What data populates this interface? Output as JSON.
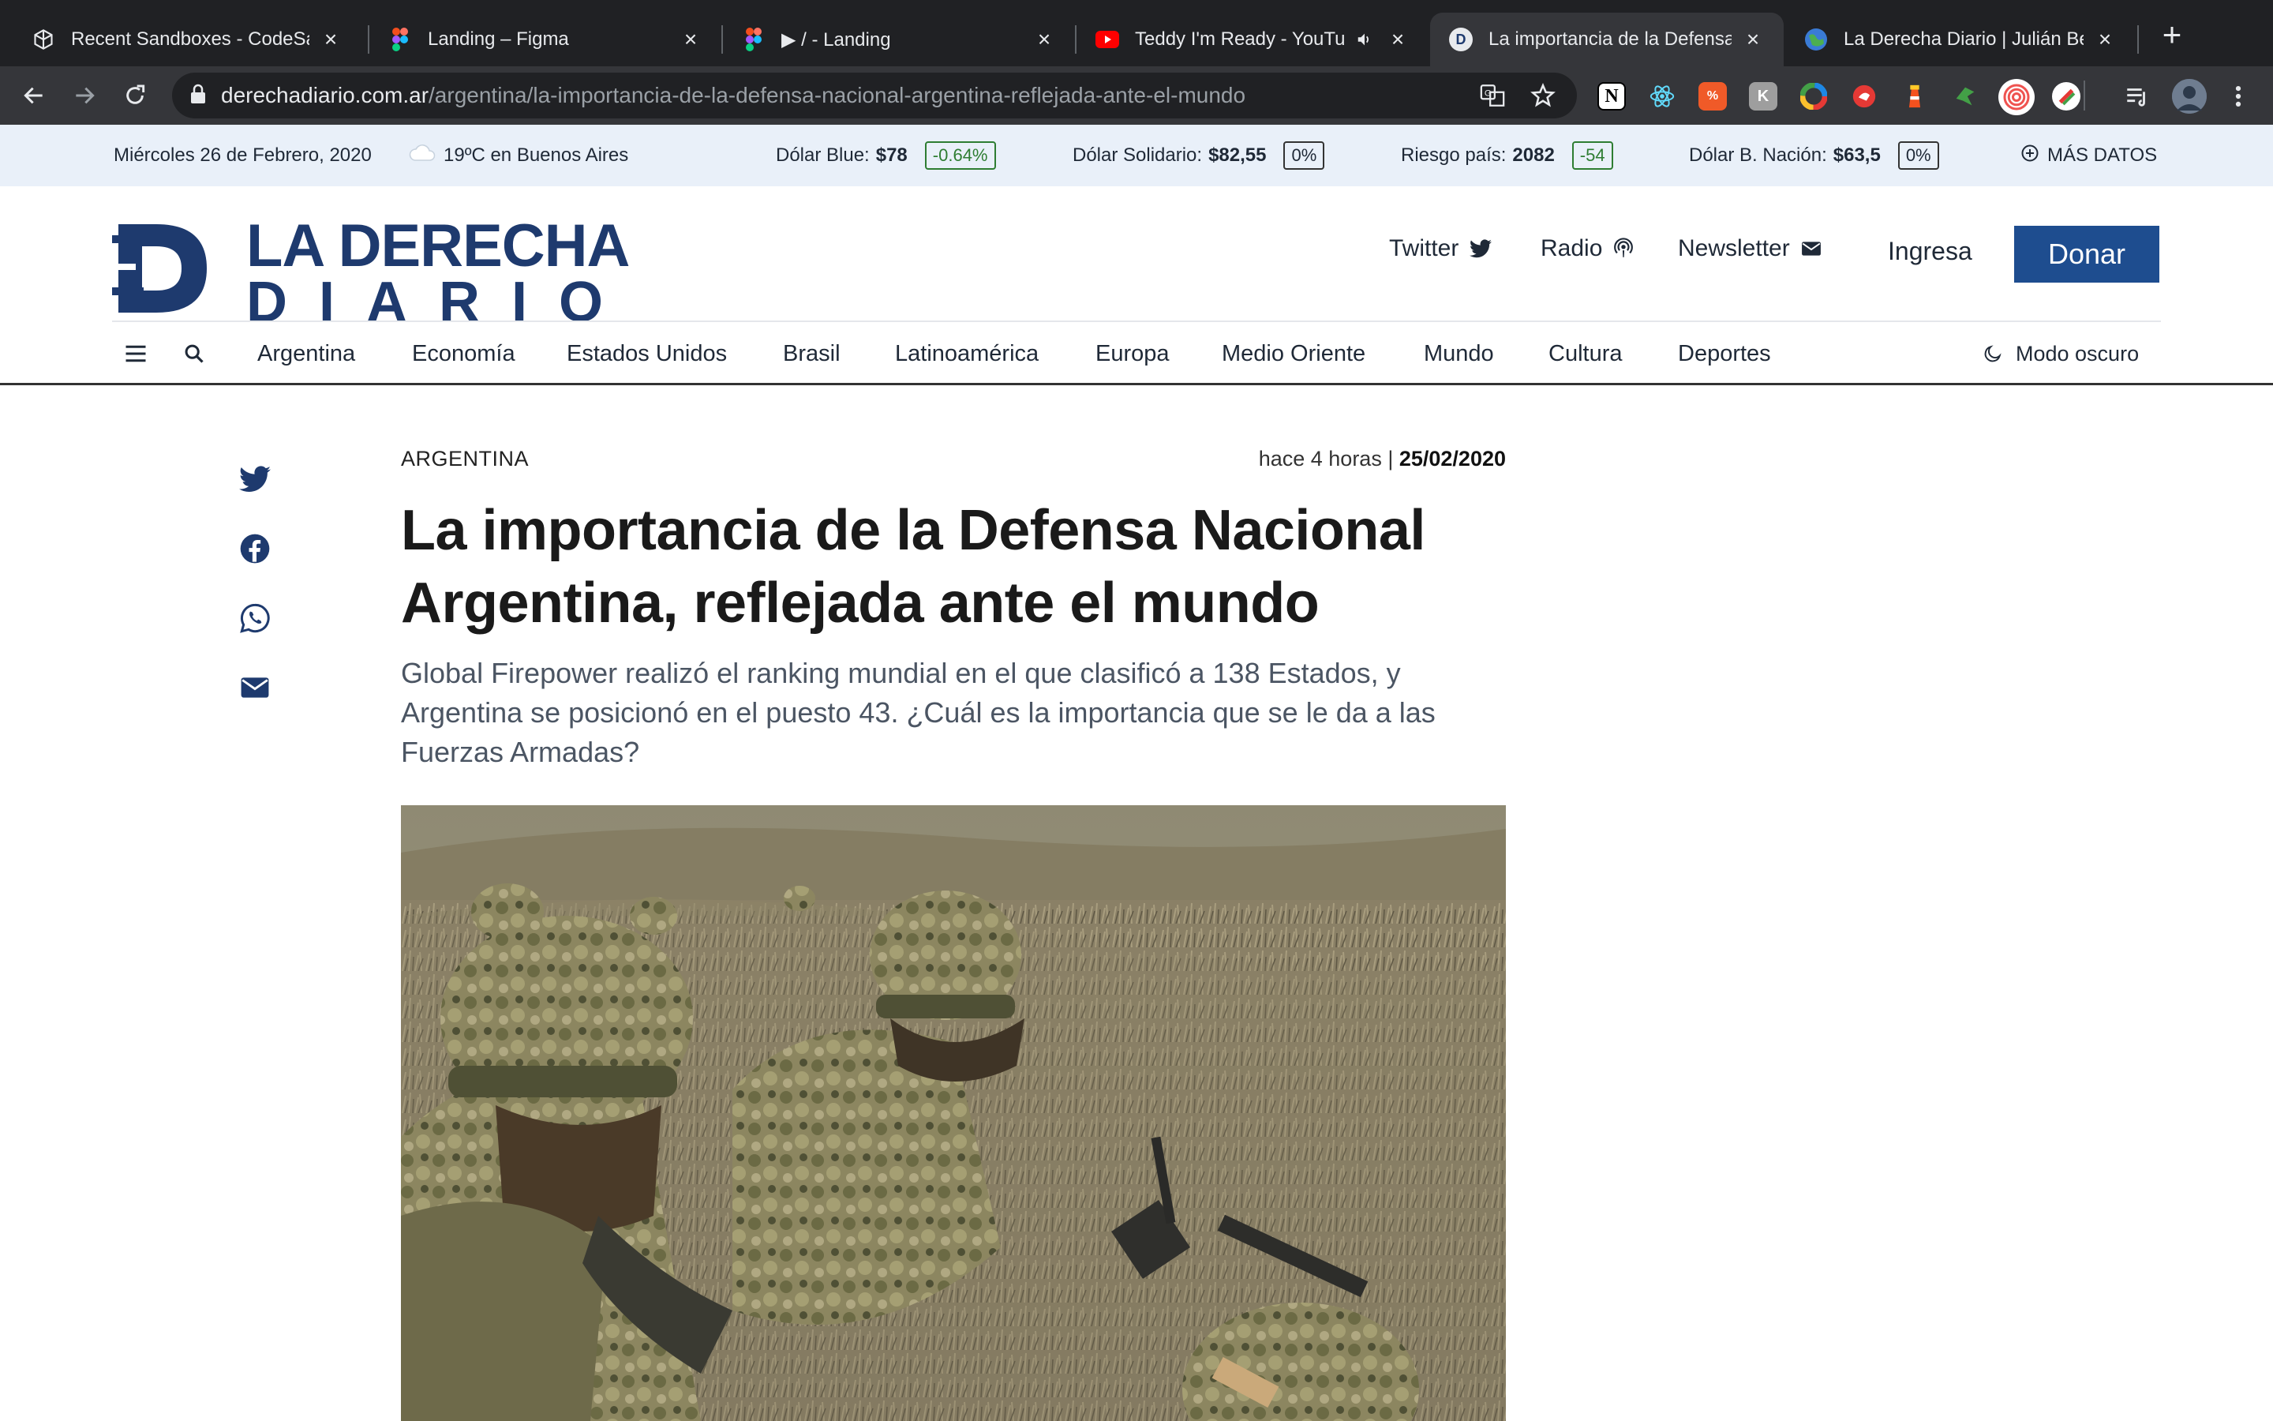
{
  "browser": {
    "tabs": [
      {
        "title": "Recent Sandboxes - CodeSandbox",
        "icon": "codesandbox-icon",
        "active": false
      },
      {
        "title": "Landing – Figma",
        "icon": "figma-icon",
        "active": false
      },
      {
        "title": "▶ / - Landing",
        "icon": "figma-icon",
        "active": false
      },
      {
        "title": "Teddy I'm Ready - YouTube",
        "icon": "youtube-icon",
        "active": false
      },
      {
        "title": "La importancia de la Defensa Nacional",
        "icon": "laderecha-icon",
        "active": true
      },
      {
        "title": "La Derecha Diario | Julián Ben",
        "icon": "globe-icon",
        "active": false
      }
    ],
    "url_host": "derechadiario.com.ar",
    "url_path": "/argentina/la-importancia-de-la-defensa-nacional-argentina-reflejada-ante-el-mundo",
    "extensions": [
      {
        "icon": "notion-icon",
        "label": "N",
        "color": "#ffffff"
      },
      {
        "icon": "react-devtools-icon",
        "label": "⚛",
        "color": "#61dafb"
      },
      {
        "icon": "ext-orange-icon",
        "label": "ⁿ∕ₐ",
        "color": "#f05a28"
      },
      {
        "icon": "ext-grey-icon",
        "label": "K",
        "color": "#9e9e9e"
      },
      {
        "icon": "color-wheel-icon",
        "label": "",
        "color": "#8e44ad"
      },
      {
        "icon": "ext-red-icon",
        "label": "",
        "color": "#e53935"
      },
      {
        "icon": "lighthouse-icon",
        "label": "",
        "color": "#f4511e"
      },
      {
        "icon": "ext-green-icon",
        "label": "",
        "color": "#43a047"
      },
      {
        "icon": "spiral-icon",
        "label": "",
        "color": "#ef5350"
      },
      {
        "icon": "ext-slash-icon",
        "label": "",
        "color": "#ffffff"
      }
    ]
  },
  "infobar": {
    "date": "Miércoles 26 de Febrero, 2020",
    "weather": "19ºC en Buenos Aires",
    "dolar_blue_label": "Dólar Blue:",
    "dolar_blue_value": "$78",
    "dolar_blue_change": "-0.64%",
    "dolar_solidario_label": "Dólar Solidario:",
    "dolar_solidario_value": "$82,55",
    "dolar_solidario_change": "0%",
    "riesgo_label": "Riesgo país:",
    "riesgo_value": "2082",
    "riesgo_change": "-54",
    "dolar_nacion_label": "Dólar B. Nación:",
    "dolar_nacion_value": "$63,5",
    "dolar_nacion_change": "0%",
    "more_label": "MÁS DATOS"
  },
  "header": {
    "logo_line1": "LA DERECHA",
    "logo_line2": "DIARIO",
    "twitter": "Twitter",
    "radio": "Radio",
    "newsletter": "Newsletter",
    "login": "Ingresa",
    "donate": "Donar",
    "brand_color": "#1e3a6e"
  },
  "nav": {
    "categories": [
      "Argentina",
      "Economía",
      "Estados Unidos",
      "Brasil",
      "Latinoamérica",
      "Europa",
      "Medio Oriente",
      "Mundo",
      "Cultura",
      "Deportes"
    ],
    "dark_mode": "Modo oscuro"
  },
  "article": {
    "section": "ARGENTINA",
    "time_ago": "hace 4 horas |",
    "date": "25/02/2020",
    "title": "La importancia de la Defensa Nacional Argentina, reflejada ante el mundo",
    "subtitle": "Global Firepower realizó el ranking mundial en el que clasificó a 138 Estados, y Argentina se posicionó en el puesto 43. ¿Cuál es la importancia que se le da a las Fuerzas Armadas?"
  }
}
